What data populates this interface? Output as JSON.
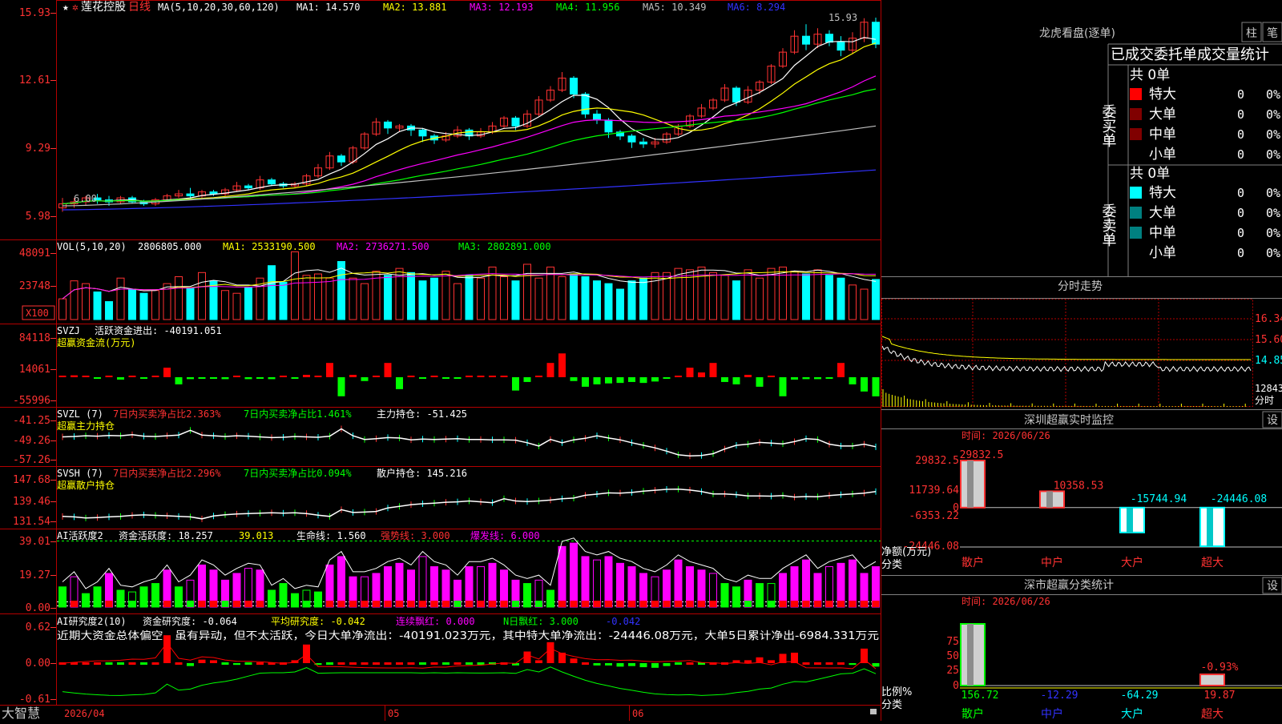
{
  "app": {
    "brand": "大智慧",
    "stock_name": "莲花控股",
    "period": "日线"
  },
  "colors": {
    "up": "#ff3232",
    "down": "#00ffff",
    "frame": "#b40000",
    "axis": "#ff3232",
    "white": "#ffffff",
    "yellow": "#ffff00",
    "magenta": "#ff00ff",
    "green": "#00ff00",
    "grey": "#c0c0c0",
    "blue": "#3232ff"
  },
  "date_axis": {
    "start": "2026/04",
    "m05": "05",
    "m06": "06"
  },
  "price_panel": {
    "legend": {
      "params": "MA(5,10,20,30,60,120)",
      "ma1": "MA1: 14.570",
      "ma2": "MA2: 13.881",
      "ma3": "MA3: 12.193",
      "ma4": "MA4: 11.956",
      "ma5": "MA5: 10.349",
      "ma6": "MA6: 8.294"
    },
    "y_ticks": [
      "15.93",
      "12.61",
      "9.29",
      "5.98"
    ],
    "high_label": "15.93",
    "low_label": "6.00"
  },
  "vol_panel": {
    "legend": {
      "params": "VOL(5,10,20)",
      "vol": "2806805.000",
      "ma1": "MA1: 2533190.500",
      "ma2": "MA2: 2736271.500",
      "ma3": "MA3: 2802891.000"
    },
    "y_ticks": [
      "48091",
      "23748"
    ],
    "unit": "X100"
  },
  "svzj_panel": {
    "name": "SVZJ",
    "line1": "活跃资金进出: -40191.051",
    "sub": "超赢资金流(万元)",
    "y_ticks": [
      "84118",
      "14061",
      "-55996"
    ]
  },
  "svzl_panel": {
    "name": "SVZL (7)",
    "t1": "7日内买卖净占比2.363%",
    "t2": "7日内买卖净占比1.461%",
    "t3": "主力持仓: -51.425",
    "sub": "超赢主力持仓",
    "y_ticks": [
      "-41.25",
      "-49.26",
      "-57.26"
    ]
  },
  "svsh_panel": {
    "name": "SVSH (7)",
    "t1": "7日内买卖净占比2.296%",
    "t2": "7日内买卖净占比0.094%",
    "t3": "散户持仓: 145.216",
    "sub": "超赢散户持仓",
    "y_ticks": [
      "147.68",
      "139.46",
      "131.54"
    ]
  },
  "ai1_panel": {
    "name": "AI活跃度2",
    "t1": "资金活跃度: 18.257",
    "t2": "39.013",
    "t3": "生命线: 1.560",
    "t4": "强势线: 3.000",
    "t5": "爆发线: 6.000",
    "y_ticks": [
      "39.01",
      "19.27",
      "0.00"
    ]
  },
  "ai2_panel": {
    "name": "AI研究度2(10)",
    "t1": "资金研究度: -0.064",
    "t2": "平均研究度: -0.042",
    "t3": "连续飘红: 0.000",
    "t4": "N日飘红: 3.000",
    "t5": "-0.042",
    "comment": "近期大资金总体偏空，虽有异动，但不太活跃，今日大单净流出：-40191.023万元，其中特大单净流出：-24446.08万元，大单5日累计净出-6984.331万元",
    "y_ticks": [
      "0.62",
      "0.00",
      "-0.61"
    ]
  },
  "longhu": {
    "title": "龙虎看盘(逐单)",
    "btn_bar": "柱",
    "btn_pen": "笔",
    "tabs": [
      "已成交",
      "委托单",
      "成交量统计"
    ],
    "buy": {
      "side": "委买单",
      "total": "共 0单",
      "rows": [
        {
          "label": "特大",
          "count": "0",
          "pct": "0%",
          "color": "#ff0000"
        },
        {
          "label": "大单",
          "count": "0",
          "pct": "0%",
          "color": "#800000"
        },
        {
          "label": "中单",
          "count": "0",
          "pct": "0%",
          "color": "#800000"
        },
        {
          "label": "小单",
          "count": "0",
          "pct": "0%",
          "color": ""
        }
      ]
    },
    "sell": {
      "side": "委卖单",
      "total": "共 0单",
      "rows": [
        {
          "label": "特大",
          "count": "0",
          "pct": "0%",
          "color": "#00ffff"
        },
        {
          "label": "大单",
          "count": "0",
          "pct": "0%",
          "color": "#008080"
        },
        {
          "label": "中单",
          "count": "0",
          "pct": "0%",
          "color": "#008080"
        },
        {
          "label": "小单",
          "count": "0",
          "pct": "0%",
          "color": ""
        }
      ]
    }
  },
  "intraday": {
    "title": "分时走势",
    "y_ticks": [
      "16.34",
      "15.60",
      "14.85"
    ],
    "vol_label": "12843",
    "tab": "分时"
  },
  "monitor": {
    "title": "深圳超赢实时监控",
    "set": "设",
    "time": "时间: 2026/06/26",
    "y_ticks": [
      "29832.5",
      "11739.64",
      "0",
      "-6353.22",
      "-24446.08"
    ],
    "ylabel1": "净额(万元)",
    "ylabel2": "分类",
    "categories": [
      "散户",
      "中户",
      "大户",
      "超大"
    ],
    "value_labels": [
      "29832.5",
      "10358.53",
      "-15744.94",
      "-24446.08"
    ]
  },
  "classify": {
    "title": "深市超赢分类统计",
    "set": "设",
    "time": "时间: 2026/06/26",
    "y_ticks": [
      "75",
      "50",
      "25",
      "0"
    ],
    "pct_label": "-0.93%",
    "ylabel1": "比例%",
    "ylabel2": "分类",
    "values": [
      "156.72",
      "-12.29",
      "-64.29",
      "19.87"
    ],
    "categories": [
      "散户",
      "中户",
      "大户",
      "超大"
    ]
  },
  "chart_data": [
    {
      "type": "candlestick",
      "title": "莲花控股 日线",
      "x": [
        "2026/04",
        "05",
        "06"
      ],
      "ylim": [
        5.98,
        15.93
      ],
      "candles": [
        [
          6.4,
          6.6,
          6.2,
          6.9
        ],
        [
          6.6,
          6.7,
          6.4,
          6.9
        ],
        [
          6.7,
          6.9,
          6.5,
          7.0
        ],
        [
          6.9,
          6.8,
          6.6,
          7.1
        ],
        [
          6.8,
          6.7,
          6.5,
          7.0
        ],
        [
          6.7,
          6.9,
          6.6,
          7.0
        ],
        [
          6.9,
          6.7,
          6.6,
          7.0
        ],
        [
          6.7,
          6.6,
          6.5,
          6.8
        ],
        [
          6.6,
          6.8,
          6.5,
          6.9
        ],
        [
          6.8,
          7.0,
          6.7,
          7.1
        ],
        [
          7.0,
          7.1,
          6.9,
          7.3
        ],
        [
          7.1,
          7.0,
          6.8,
          7.4
        ],
        [
          7.0,
          7.2,
          6.9,
          7.3
        ],
        [
          7.2,
          7.1,
          7.0,
          7.3
        ],
        [
          7.1,
          7.3,
          7.0,
          7.4
        ],
        [
          7.3,
          7.5,
          7.2,
          7.7
        ],
        [
          7.5,
          7.4,
          7.3,
          7.6
        ],
        [
          7.4,
          7.8,
          7.3,
          8.0
        ],
        [
          7.8,
          7.6,
          7.5,
          7.9
        ],
        [
          7.6,
          7.5,
          7.4,
          7.7
        ],
        [
          7.5,
          7.6,
          7.4,
          7.7
        ],
        [
          7.6,
          8.0,
          7.5,
          8.1
        ],
        [
          8.0,
          8.4,
          7.9,
          8.6
        ],
        [
          8.4,
          9.0,
          8.3,
          9.2
        ],
        [
          9.0,
          8.7,
          8.5,
          9.1
        ],
        [
          8.7,
          9.4,
          8.6,
          9.5
        ],
        [
          9.4,
          10.1,
          9.3,
          10.2
        ],
        [
          10.1,
          10.7,
          10.0,
          10.9
        ],
        [
          10.7,
          10.4,
          10.1,
          10.8
        ],
        [
          10.4,
          10.5,
          10.2,
          10.6
        ],
        [
          10.5,
          10.3,
          10.0,
          10.6
        ],
        [
          10.3,
          10.0,
          9.7,
          10.4
        ],
        [
          10.0,
          9.8,
          9.6,
          10.1
        ],
        [
          9.8,
          10.0,
          9.7,
          10.2
        ],
        [
          10.0,
          10.3,
          9.9,
          10.5
        ],
        [
          10.3,
          10.0,
          9.8,
          10.4
        ],
        [
          10.0,
          10.2,
          9.9,
          10.4
        ],
        [
          10.2,
          10.5,
          10.1,
          10.7
        ],
        [
          10.5,
          10.9,
          10.4,
          11.0
        ],
        [
          10.9,
          10.5,
          10.3,
          11.0
        ],
        [
          10.5,
          11.1,
          10.4,
          11.3
        ],
        [
          11.1,
          11.8,
          11.0,
          12.0
        ],
        [
          11.8,
          12.3,
          11.7,
          12.5
        ],
        [
          12.3,
          12.9,
          12.2,
          13.2
        ],
        [
          12.9,
          12.1,
          11.9,
          13.0
        ],
        [
          12.1,
          11.1,
          10.9,
          12.2
        ],
        [
          11.1,
          10.8,
          10.6,
          11.3
        ],
        [
          10.8,
          10.2,
          9.9,
          10.9
        ],
        [
          10.2,
          10.0,
          9.8,
          10.3
        ],
        [
          10.0,
          9.7,
          9.4,
          10.1
        ],
        [
          9.7,
          9.6,
          9.4,
          9.9
        ],
        [
          9.6,
          9.7,
          9.4,
          9.9
        ],
        [
          9.7,
          10.1,
          9.6,
          10.2
        ],
        [
          10.1,
          10.5,
          10.0,
          10.6
        ],
        [
          10.5,
          11.0,
          10.4,
          11.1
        ],
        [
          11.0,
          11.4,
          10.9,
          11.6
        ],
        [
          11.4,
          11.8,
          11.3,
          11.9
        ],
        [
          11.8,
          12.4,
          11.7,
          12.6
        ],
        [
          12.4,
          11.7,
          11.5,
          12.5
        ],
        [
          11.7,
          12.3,
          11.6,
          12.5
        ],
        [
          12.3,
          12.7,
          12.1,
          12.8
        ],
        [
          12.7,
          13.5,
          12.6,
          13.6
        ],
        [
          13.5,
          14.2,
          13.4,
          14.4
        ],
        [
          14.2,
          15.0,
          14.1,
          15.3
        ],
        [
          15.0,
          14.6,
          14.3,
          15.6
        ],
        [
          14.6,
          15.1,
          14.4,
          15.4
        ],
        [
          15.1,
          14.7,
          14.5,
          15.3
        ],
        [
          14.7,
          14.3,
          14.0,
          15.0
        ],
        [
          14.3,
          14.9,
          14.1,
          15.2
        ],
        [
          14.9,
          15.7,
          14.7,
          15.9
        ],
        [
          15.7,
          14.6,
          14.4,
          15.93
        ]
      ]
    },
    {
      "type": "bar",
      "title": "VOL(5,10,20)",
      "values": [
        15000,
        28000,
        26000,
        20000,
        13000,
        30000,
        22000,
        19000,
        21000,
        26000,
        31000,
        23000,
        34000,
        28000,
        21000,
        19000,
        23000,
        30000,
        39000,
        27000,
        49000,
        32000,
        33000,
        30000,
        42000,
        30000,
        26000,
        35000,
        32000,
        37000,
        34000,
        28000,
        30000,
        35000,
        26000,
        32000,
        30000,
        38000,
        31000,
        28000,
        40000,
        30000,
        38000,
        31000,
        33000,
        31000,
        28000,
        26000,
        22000,
        28000,
        30000,
        34000,
        34000,
        37000,
        36000,
        38000,
        34000,
        32000,
        28000,
        36000,
        30000,
        37000,
        38000,
        35000,
        33000,
        36000,
        32000,
        30000,
        25000,
        22000,
        29000
      ],
      "ylim": [
        0,
        48091
      ]
    },
    {
      "type": "bar",
      "title": "SVZJ 活跃资金进出",
      "values": [
        3000,
        4000,
        2000,
        -3000,
        2000,
        -5000,
        1000,
        -2000,
        3000,
        20000,
        -15000,
        -4000,
        -3000,
        -3000,
        -4000,
        1000,
        -4000,
        -3000,
        -4000,
        3000,
        -2000,
        5000,
        2000,
        30000,
        -40000,
        5000,
        -8000,
        3000,
        30000,
        -25000,
        3000,
        -2000,
        1000,
        -1000,
        -1000,
        0,
        2000,
        2000,
        3000,
        -28000,
        -10000,
        3000,
        30000,
        50000,
        -8000,
        -20000,
        -15000,
        -13000,
        -12000,
        -10000,
        -12000,
        -9000,
        -3000,
        1000,
        20000,
        10000,
        30000,
        -10000,
        -15000,
        5000,
        -20000,
        3000,
        -40000,
        -5000,
        -4000,
        -4000,
        -3000,
        30000,
        -15000,
        -30000,
        -40191
      ]
    },
    {
      "type": "line",
      "title": "SVZL 主力持仓",
      "values": [
        -50.8,
        -50.7,
        -50.5,
        -50.6,
        -50.4,
        -50.5,
        -50.2,
        -50.6,
        -50.7,
        -50.5,
        -50.3,
        -49.0,
        -50.3,
        -50.5,
        -50.7,
        -50.5,
        -50.6,
        -50.8,
        -51.0,
        -50.9,
        -50.7,
        -50.8,
        -50.9,
        -50.6,
        -48.6,
        -50.5,
        -51.5,
        -51.3,
        -51.0,
        -51.1,
        -51.6,
        -51.4,
        -51.5,
        -51.4,
        -51.3,
        -51.5,
        -51.5,
        -51.6,
        -51.6,
        -51.7,
        -52.4,
        -53.3,
        -51.5,
        -52.4,
        -51.6,
        -51.2,
        -50.5,
        -51.1,
        -51.6,
        -52.4,
        -53.1,
        -53.8,
        -54.7,
        -55.7,
        -56.0,
        -55.9,
        -55.4,
        -54.1,
        -53.1,
        -52.8,
        -52.3,
        -52.5,
        -52.7,
        -52.1,
        -51.3,
        -51.5,
        -52.8,
        -53.3,
        -53.3,
        -52.8,
        -53.5
      ]
    },
    {
      "type": "line",
      "title": "SVSH 散户持仓",
      "values": [
        133.8,
        133.6,
        133.1,
        133.3,
        133.6,
        133.8,
        134.3,
        134.5,
        134.3,
        134.1,
        133.8,
        133.6,
        132.7,
        134.0,
        134.6,
        134.9,
        135.1,
        135.3,
        135.5,
        135.3,
        135.5,
        135.1,
        134.4,
        133.8,
        136.9,
        135.6,
        135.8,
        136.1,
        137.7,
        138.4,
        139.2,
        139.6,
        139.9,
        140.3,
        140.5,
        140.9,
        140.5,
        140.1,
        141.9,
        140.9,
        140.6,
        140.9,
        141.3,
        141.9,
        142.2,
        143.5,
        144.0,
        144.6,
        144.5,
        144.8,
        145.4,
        145.8,
        146.2,
        146.3,
        145.9,
        145.2,
        144.1,
        144.1,
        143.8,
        143.2,
        143.2,
        143.1,
        143.4,
        142.7,
        142.9,
        142.8,
        143.4,
        143.8,
        144.1,
        144.5,
        145.2
      ]
    },
    {
      "type": "bar",
      "title": "AI活跃度2 资金活跃度",
      "values": [
        12,
        18,
        8,
        12,
        20,
        10,
        9,
        12,
        14,
        22,
        12,
        16,
        25,
        22,
        16,
        20,
        23,
        22,
        10,
        14,
        8,
        10,
        9,
        25,
        30,
        18,
        18,
        20,
        24,
        26,
        22,
        30,
        24,
        22,
        16,
        24,
        24,
        26,
        22,
        16,
        14,
        16,
        10,
        36,
        38,
        30,
        28,
        30,
        26,
        24,
        20,
        18,
        22,
        28,
        24,
        22,
        20,
        14,
        12,
        16,
        14,
        14,
        20,
        24,
        28,
        20,
        24,
        26,
        28,
        20,
        24
      ]
    },
    {
      "type": "bar",
      "title": "AI研究度2(10) 资金研究度",
      "values": [
        0,
        0,
        0,
        0,
        -0.02,
        -0.02,
        0,
        -0.02,
        0.02,
        0.48,
        0,
        -0.05,
        0.06,
        0.05,
        -0.01,
        -0.03,
        -0.01,
        0,
        0,
        0,
        0.05,
        0.32,
        -0.03,
        -0.01,
        0,
        0,
        0,
        0,
        0,
        0,
        0,
        -0.02,
        0,
        -0.02,
        0,
        -0.01,
        -0.02,
        -0.01,
        0,
        -0.04,
        0.2,
        0.05,
        0.36,
        0.18,
        0.08,
        0,
        -0.04,
        -0.04,
        -0.06,
        -0.05,
        -0.07,
        -0.08,
        -0.05,
        -0.02,
        0.02,
        -0.02,
        0,
        0,
        0.05,
        0.05,
        0.1,
        0.05,
        0.16,
        0.18,
        0,
        0,
        0,
        0,
        -0.03,
        0.25,
        -0.06
      ]
    },
    {
      "type": "bar",
      "title": "深圳超赢实时监控",
      "categories": [
        "散户",
        "中户",
        "大户",
        "超大"
      ],
      "values": [
        29832.5,
        10358.53,
        -15744.94,
        -24446.08
      ],
      "ylim": [
        -24446.08,
        29832.5
      ]
    },
    {
      "type": "bar",
      "title": "深市超赢分类统计",
      "categories": [
        "散户",
        "中户",
        "大户",
        "超大"
      ],
      "values": [
        156.72,
        -12.29,
        -64.29,
        19.87
      ]
    }
  ]
}
